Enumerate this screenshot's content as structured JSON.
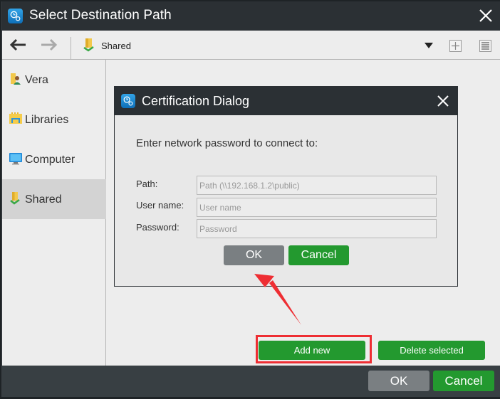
{
  "window": {
    "title": "Select Destination Path",
    "icon": "clock-gear-app-icon",
    "close_icon": "close-icon"
  },
  "toolbar": {
    "back_icon": "arrow-left-icon",
    "forward_icon": "arrow-right-icon",
    "forward_enabled": false,
    "breadcrumb": "Shared",
    "breadcrumb_icon": "shared-folder-icon",
    "dropdown_icon": "triangle-down-icon",
    "new_folder_icon": "plus-box-icon",
    "view_icon": "list-view-icon"
  },
  "sidebar": {
    "items": [
      {
        "label": "Vera",
        "icon": "user-folder-icon",
        "selected": false
      },
      {
        "label": "Libraries",
        "icon": "libraries-icon",
        "selected": false
      },
      {
        "label": "Computer",
        "icon": "computer-icon",
        "selected": false
      },
      {
        "label": "Shared",
        "icon": "shared-folder-icon",
        "selected": true
      }
    ]
  },
  "actions": {
    "add_new": "Add new",
    "delete_selected": "Delete selected"
  },
  "footer": {
    "ok": "OK",
    "cancel": "Cancel"
  },
  "dialog": {
    "title": "Certification Dialog",
    "prompt": "Enter network password to connect to:",
    "fields": [
      {
        "label": "Path:",
        "placeholder": "Path (\\\\192.168.1.2\\public)",
        "value": ""
      },
      {
        "label": "User name:",
        "placeholder": "User name",
        "value": ""
      },
      {
        "label": "Password:",
        "placeholder": "Password",
        "value": ""
      }
    ],
    "ok": "OK",
    "cancel": "Cancel"
  },
  "annotation": {
    "highlight_color": "#ee2e33",
    "arrow_color": "#ee2e33",
    "highlighted_target": "Add new"
  },
  "colors": {
    "titlebar": "#2b3034",
    "footer": "#383f43",
    "green_button": "#23992f",
    "gray_button": "#7a7f82",
    "selected_item": "#d3d3d3"
  }
}
